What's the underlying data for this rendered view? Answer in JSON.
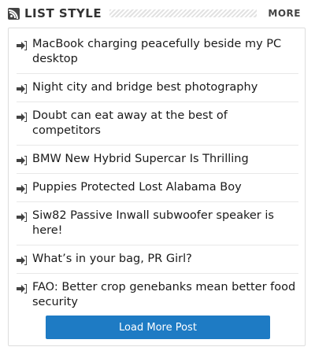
{
  "header": {
    "title": "LIST STYLE",
    "icon": "rss-icon",
    "more_label": "MORE"
  },
  "posts": [
    {
      "title": "MacBook charging peacefully beside my PC desktop"
    },
    {
      "title": "Night city and bridge best photography"
    },
    {
      "title": "Doubt can eat away at the best of competitors"
    },
    {
      "title": "BMW New Hybrid Supercar Is Thrilling"
    },
    {
      "title": "Puppies Protected Lost Alabama Boy"
    },
    {
      "title": "Siw82 Passive Inwall subwoofer speaker is here!"
    },
    {
      "title": "What’s in your bag, PR Girl?"
    },
    {
      "title": "FAO: Better crop genebanks mean better food security"
    }
  ],
  "load_more_label": "Load More Post",
  "colors": {
    "accent": "#1e7bc4",
    "text": "#1a1a1a",
    "border": "#dddddd"
  }
}
